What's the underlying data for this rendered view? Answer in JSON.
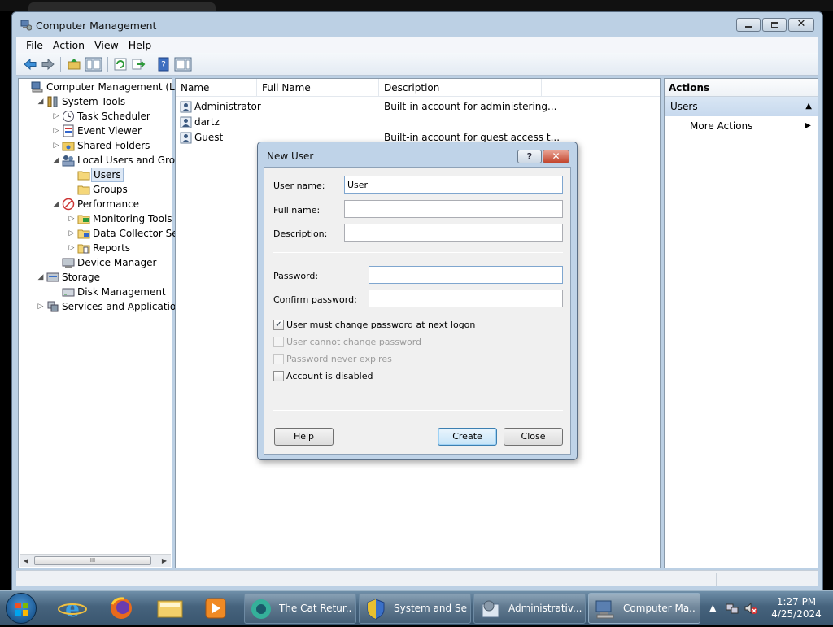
{
  "window": {
    "title": "Computer Management",
    "menu": [
      "File",
      "Action",
      "View",
      "Help"
    ]
  },
  "tree": [
    {
      "label": "Computer Management (Local",
      "level": 0,
      "expander": "",
      "icon": "computer-management-icon"
    },
    {
      "label": "System Tools",
      "level": 1,
      "expander": "expanded",
      "icon": "tools-icon"
    },
    {
      "label": "Task Scheduler",
      "level": 2,
      "expander": "collapsed",
      "icon": "clock-icon"
    },
    {
      "label": "Event Viewer",
      "level": 2,
      "expander": "collapsed",
      "icon": "event-viewer-icon"
    },
    {
      "label": "Shared Folders",
      "level": 2,
      "expander": "collapsed",
      "icon": "shared-folder-icon"
    },
    {
      "label": "Local Users and Groups",
      "level": 2,
      "expander": "expanded",
      "icon": "users-group-icon"
    },
    {
      "label": "Users",
      "level": 3,
      "expander": "",
      "icon": "folder-icon",
      "selected": true
    },
    {
      "label": "Groups",
      "level": 3,
      "expander": "",
      "icon": "folder-icon"
    },
    {
      "label": "Performance",
      "level": 2,
      "expander": "expanded",
      "icon": "performance-icon"
    },
    {
      "label": "Monitoring Tools",
      "level": 3,
      "expander": "collapsed",
      "icon": "monitor-folder-icon"
    },
    {
      "label": "Data Collector Sets",
      "level": 3,
      "expander": "collapsed",
      "icon": "data-folder-icon"
    },
    {
      "label": "Reports",
      "level": 3,
      "expander": "collapsed",
      "icon": "report-folder-icon"
    },
    {
      "label": "Device Manager",
      "level": 2,
      "expander": "",
      "icon": "device-manager-icon"
    },
    {
      "label": "Storage",
      "level": 1,
      "expander": "expanded",
      "icon": "storage-icon"
    },
    {
      "label": "Disk Management",
      "level": 2,
      "expander": "",
      "icon": "disk-icon"
    },
    {
      "label": "Services and Applications",
      "level": 1,
      "expander": "collapsed",
      "icon": "services-icon"
    }
  ],
  "list": {
    "columns": [
      "Name",
      "Full Name",
      "Description"
    ],
    "rows": [
      {
        "name": "Administrator",
        "full_name": "",
        "description": "Built-in account for administering..."
      },
      {
        "name": "dartz",
        "full_name": "",
        "description": ""
      },
      {
        "name": "Guest",
        "full_name": "",
        "description": "Built-in account for guest access t..."
      }
    ]
  },
  "actions": {
    "header": "Actions",
    "section": "Users",
    "more": "More Actions"
  },
  "dialog": {
    "title": "New User",
    "help_glyph": "?",
    "close_glyph": "✕",
    "fields": {
      "username_label": "User name:",
      "username_value": "User",
      "fullname_label": "Full name:",
      "fullname_value": "",
      "description_label": "Description:",
      "description_value": "",
      "password_label": "Password:",
      "password_value": "",
      "confirm_label": "Confirm password:",
      "confirm_value": ""
    },
    "checkboxes": [
      {
        "label": "User must change password at next logon",
        "checked": true,
        "disabled": false
      },
      {
        "label": "User cannot change password",
        "checked": false,
        "disabled": true
      },
      {
        "label": "Password never expires",
        "checked": false,
        "disabled": true
      },
      {
        "label": "Account is disabled",
        "checked": false,
        "disabled": false
      }
    ],
    "buttons": {
      "help": "Help",
      "create": "Create",
      "close": "Close"
    }
  },
  "taskbar": {
    "tasks": [
      {
        "label": "The Cat Retur..."
      },
      {
        "label": "System and Se..."
      },
      {
        "label": "Administrativ..."
      },
      {
        "label": "Computer Ma..."
      }
    ],
    "time": "1:27 PM",
    "date": "4/25/2024"
  },
  "scroll_thumb_glyph": "III",
  "colors": {
    "accent": "#3c7fb1",
    "titlebar": "#bcd0e4",
    "taskbar": "#46637d"
  }
}
